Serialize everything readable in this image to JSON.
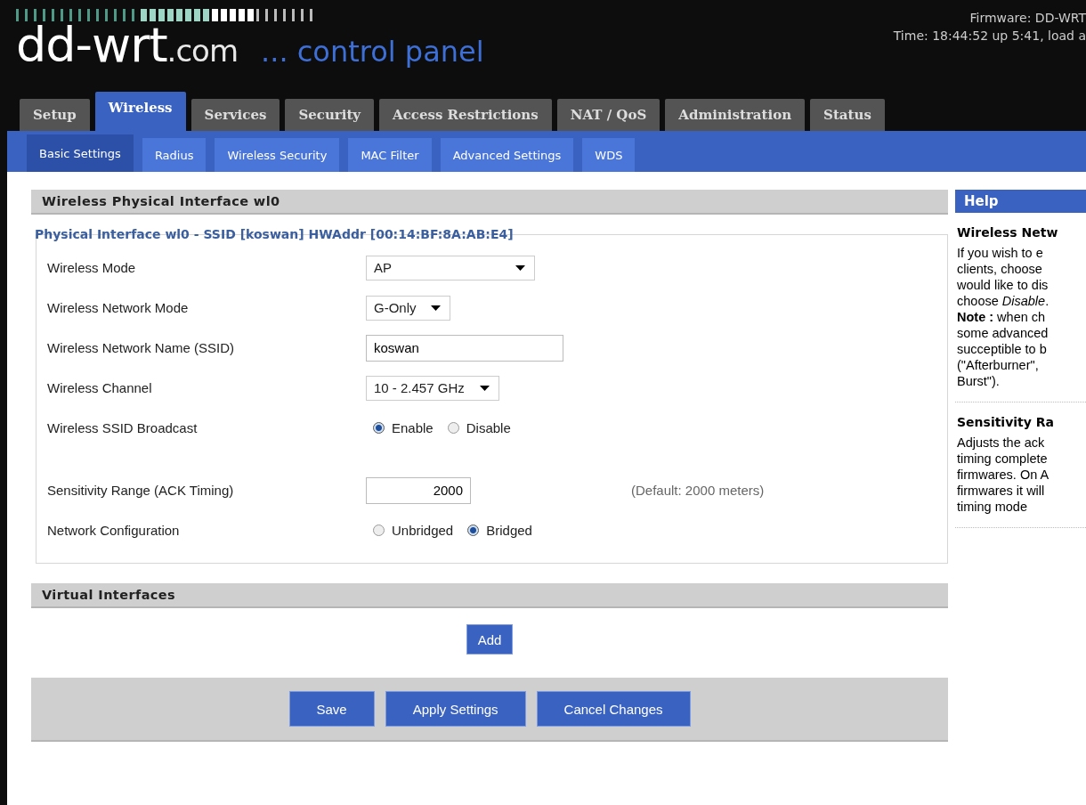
{
  "header": {
    "logo": "dd-wrt",
    "logo_suffix": ".com",
    "tagline": "... control panel",
    "firmware": "Firmware: DD-WRT",
    "uptime": "Time: 18:44:52 up 5:41, load a"
  },
  "tabs": [
    {
      "label": "Setup",
      "selected": false
    },
    {
      "label": "Wireless",
      "selected": true
    },
    {
      "label": "Services",
      "selected": false
    },
    {
      "label": "Security",
      "selected": false
    },
    {
      "label": "Access Restrictions",
      "selected": false
    },
    {
      "label": "NAT / QoS",
      "selected": false
    },
    {
      "label": "Administration",
      "selected": false
    },
    {
      "label": "Status",
      "selected": false
    }
  ],
  "subtabs": [
    {
      "label": "Basic Settings",
      "selected": true
    },
    {
      "label": "Radius",
      "selected": false
    },
    {
      "label": "Wireless Security",
      "selected": false
    },
    {
      "label": "MAC Filter",
      "selected": false
    },
    {
      "label": "Advanced Settings",
      "selected": false
    },
    {
      "label": "WDS",
      "selected": false
    }
  ],
  "section": {
    "title": "Wireless Physical Interface wl0"
  },
  "fieldset": {
    "legend": "Physical Interface wl0 - SSID [koswan] HWAddr [00:14:BF:8A:AB:E4]",
    "groups": [
      [
        {
          "kind": "select",
          "label": "Wireless Mode",
          "value": "AP"
        },
        {
          "kind": "select",
          "label": "Wireless Network Mode",
          "value": "G-Only"
        },
        {
          "kind": "text",
          "label": "Wireless Network Name (SSID)",
          "value": "koswan"
        },
        {
          "kind": "select",
          "label": "Wireless Channel",
          "value": "10 - 2.457 GHz"
        },
        {
          "kind": "radio",
          "label": "Wireless SSID Broadcast",
          "options": [
            {
              "label": "Enable",
              "selected": true
            },
            {
              "label": "Disable",
              "selected": false
            }
          ]
        }
      ],
      [
        {
          "kind": "number",
          "label": "Sensitivity Range (ACK Timing)",
          "value": "2000",
          "note": "(Default: 2000 meters)"
        },
        {
          "kind": "radio",
          "label": "Network Configuration",
          "options": [
            {
              "label": "Unbridged",
              "selected": false
            },
            {
              "label": "Bridged",
              "selected": true
            }
          ]
        }
      ]
    ]
  },
  "virtual_section": {
    "title": "Virtual Interfaces",
    "button": "Add"
  },
  "buttons": [
    "Save",
    "Apply Settings",
    "Cancel Changes"
  ],
  "help": {
    "title": "Help",
    "entries": [
      {
        "title": "Wireless Netw",
        "lines": [
          "If you wish to e",
          "clients, choose",
          "would like to dis",
          "choose *Disable*.",
          "**Note :** when ch",
          "some advanced",
          "succeptible to b",
          "(\"Afterburner\",",
          "Burst\")."
        ]
      },
      {
        "title": "Sensitivity Ra",
        "lines": [
          "Adjusts the ack",
          "timing complete",
          "firmwares. On A",
          "firmwares it will",
          "timing mode"
        ]
      }
    ]
  }
}
